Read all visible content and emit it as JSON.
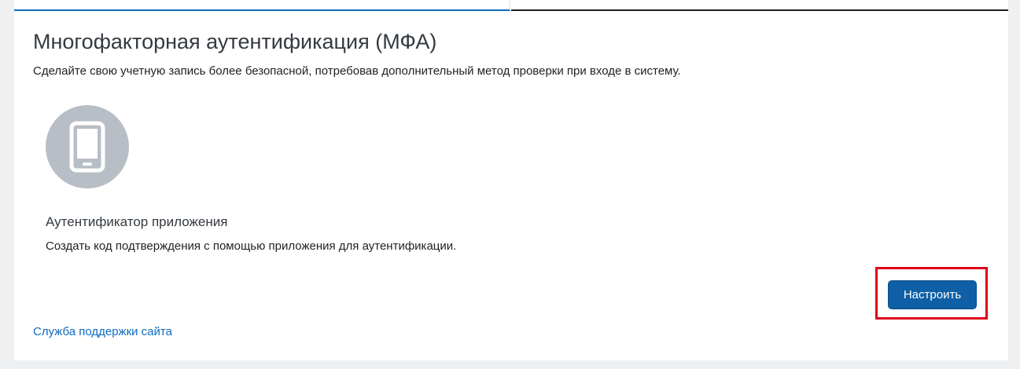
{
  "page": {
    "title": "Многофакторная аутентификация (МФА)",
    "description": "Сделайте свою учетную запись более безопасной, потребовав дополнительный метод проверки при входе в систему."
  },
  "method": {
    "icon": "mobile-phone-icon",
    "title": "Аутентификатор приложения",
    "description": "Создать код подтверждения с помощью приложения для аутентификации.",
    "button_label": "Настроить"
  },
  "footer": {
    "support_link": "Служба поддержки сайта"
  },
  "colors": {
    "accent": "#0f6cbf",
    "button": "#0f5fa6",
    "highlight": "#e0001b",
    "icon_circle": "#b8bec6"
  }
}
